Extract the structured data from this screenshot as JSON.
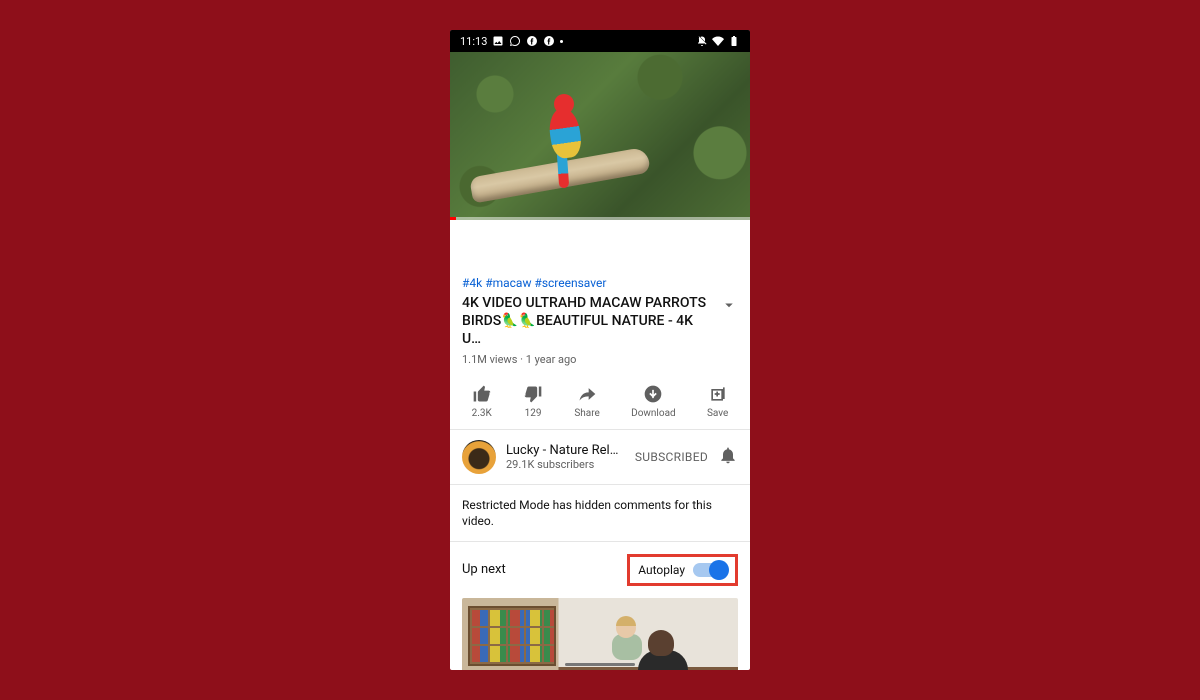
{
  "statusbar": {
    "time": "11:13"
  },
  "video": {
    "hashtags": "#4k #macaw #screensaver",
    "title": "4K VIDEO ULTRAHD MACAW PARROTS BIRDS🦜🦜BEAUTIFUL NATURE - 4K U…",
    "stats": "1.1M views · 1 year ago"
  },
  "actions": {
    "likes": "2.3K",
    "dislikes": "129",
    "share": "Share",
    "download": "Download",
    "save": "Save"
  },
  "channel": {
    "name": "Lucky - Nature Rel…",
    "subs": "29.1K subscribers",
    "subscribed": "SUBSCRIBED"
  },
  "restricted": "Restricted Mode has hidden comments for this video.",
  "upnext": {
    "label": "Up next",
    "autoplay": "Autoplay"
  }
}
